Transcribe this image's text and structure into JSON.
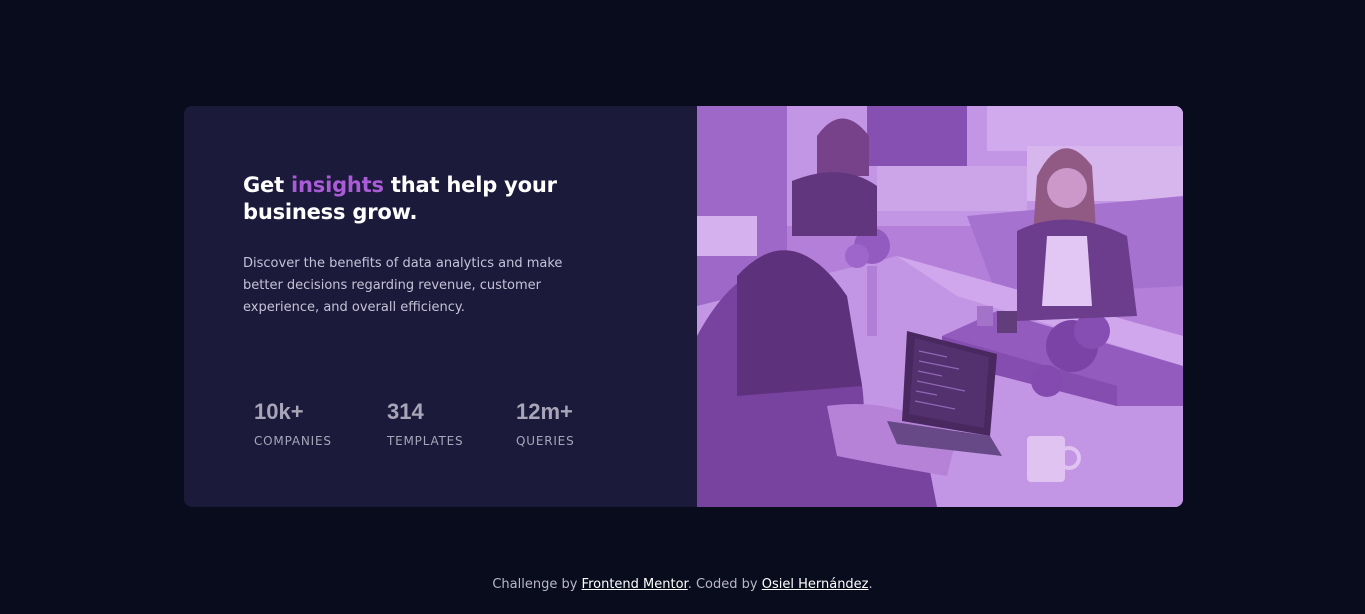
{
  "card": {
    "headline": {
      "before": "Get ",
      "accent": "insights",
      "after": " that help your business grow."
    },
    "description": "Discover the benefits of data analytics and make better decisions regarding revenue, customer experience, and overall efficiency.",
    "stats": [
      {
        "value": "10k+",
        "label": "COMPANIES"
      },
      {
        "value": "314",
        "label": "TEMPLATES"
      },
      {
        "value": "12m+",
        "label": "QUERIES"
      }
    ],
    "image_icon": "office-workers-photo"
  },
  "footer": {
    "prefix": "Challenge by ",
    "link1": "Frontend Mentor",
    "middle": ". Coded by ",
    "link2": "Osiel Hernández",
    "suffix": "."
  },
  "colors": {
    "page_background": "#090c1d",
    "card_background": "#1c1a3a",
    "accent": "#a95bd8",
    "image_tint": "#a97ed6"
  }
}
